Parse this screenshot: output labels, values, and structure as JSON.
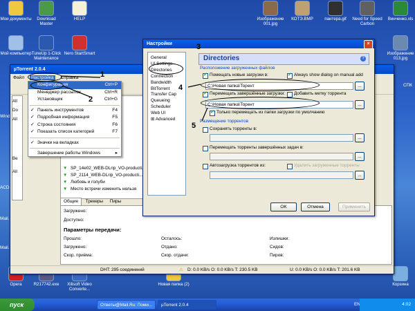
{
  "desktop_icons": [
    {
      "label": "Мои документы",
      "color": "#f0c840"
    },
    {
      "label": "Download Master",
      "color": "#4a9a4a"
    },
    {
      "label": "HELP",
      "color": "#f5f0d8"
    },
    {
      "label": "Изображение 001.jpg",
      "color": "#8a6a4a"
    },
    {
      "label": "КОТЭ.BMP",
      "color": "#c0a070"
    },
    {
      "label": "пантера.gif",
      "color": "#303030"
    },
    {
      "label": "Need for Speed Carbon",
      "color": "#606060"
    },
    {
      "label": "Винченко.xls",
      "color": "#2a8a3a"
    },
    {
      "label": "Мой компьютер",
      "color": "#a0c0e8"
    },
    {
      "label": "TuneUp 1-Click Maintenance",
      "color": "#2a5ab0"
    },
    {
      "label": "Nero StartSmart",
      "color": "#d03030"
    },
    {
      "label": "Изображение 013.jpg",
      "color": "#6a8ab0"
    },
    {
      "label": "Opera",
      "color": "#d02020"
    },
    {
      "label": "R217742.exe",
      "color": "#5a5a8a"
    },
    {
      "label": "Xilisoft Video Converte...",
      "color": "#3a6ac0"
    },
    {
      "label": "Новая папка (2)",
      "color": "#f0c840"
    },
    {
      "label": "Корзина",
      "color": "#7ab0e0"
    }
  ],
  "side_labels": [
    "Wind",
    "ACD",
    "Mail.",
    "Mail.",
    "СПК"
  ],
  "utorrent": {
    "title": "µTorrent 2.0.4",
    "menu": [
      "Файл",
      "Настройка",
      "Справка"
    ],
    "torrents": [
      "SP_14e02_WEB-DLrip_VO-producti...",
      "SP_2114_WEB-DLrip_VO-producti...",
      "Любовь и голуби",
      "Место встречи изменить нельзя"
    ],
    "list_snippet": "...DVDR...",
    "sidebar": [
      "All",
      "Do",
      "All",
      "Be",
      "All"
    ],
    "tabs": [
      "Общие",
      "Трекеры",
      "Пиры"
    ],
    "info_labels": [
      "Загружено:",
      "Доступно:"
    ],
    "params_title": "Параметры передачи:",
    "params": [
      [
        "Прошло:",
        "Осталось:",
        "Излишки:"
      ],
      [
        "Загружено:",
        "Отдано:",
        "Сидов:"
      ],
      [
        "Скор. приёма:",
        "Скор. отдачи:",
        "Пиров:"
      ]
    ],
    "status": {
      "dht": "DHT: 295 соединений",
      "down": "D: 0.0 KB/s O: 0.0 KB/s T: 230.5 KB",
      "up": "U: 0.0 KB/s O: 0.0 KB/s T: 201.6 KB"
    }
  },
  "dropdown": {
    "items": [
      {
        "label": "Конфигурация",
        "shortcut": "Ctrl+P",
        "check": false
      },
      {
        "label": "Менеджер рассылок",
        "shortcut": "Ctrl+R",
        "check": false
      },
      {
        "label": "Установщик",
        "shortcut": "Ctrl+G",
        "check": false
      },
      {
        "label": "Панель инструментов",
        "shortcut": "F4",
        "check": true
      },
      {
        "label": "Подробная информация",
        "shortcut": "F5",
        "check": true
      },
      {
        "label": "Строка состояния",
        "shortcut": "F6",
        "check": true
      },
      {
        "label": "Показать список категорий",
        "shortcut": "F7",
        "check": true
      },
      {
        "label": "Значки на вкладках",
        "shortcut": "",
        "check": true
      },
      {
        "label": "Завершение работы Windows",
        "shortcut": "▸",
        "check": false
      }
    ]
  },
  "settings": {
    "title": "Настройки",
    "tree": [
      "General",
      "UI Settings",
      "Directories",
      "Connection",
      "Bandwidth",
      "BitTorrent",
      "Transfer Cap",
      "Queueing",
      "Scheduler",
      "Web UI",
      "Advanced"
    ],
    "tree_advanced_expander": "⊞",
    "heading": "Directories",
    "help_glyph": "?",
    "section1": "Расположение загруженных файлов",
    "put_new": "Помещать новые загрузки в:",
    "always_show": "Always show dialog on manual add",
    "path1": "C:\\Новая папка\\Торент",
    "move_completed": "Перемещать завершённые загрузки:",
    "add_label": "Добавить метку торрента",
    "path2": "C:\\Новая папка\\Торент",
    "only_move": "Только перемещать из папки загрузки по умолчанию",
    "section2": "Размещение торрентов",
    "save_torrents": "Сохранять торренты в:",
    "move_finished": "Перемещать торренты завершённых задач в:",
    "autoload": "Автозагрузка торрентов из:",
    "delete_loaded": "Удалить загруженные торренты",
    "browse": "...",
    "ok": "OK",
    "cancel": "Отмена",
    "apply": "Применить"
  },
  "annotations": [
    "1",
    "2",
    "3",
    "4",
    "5"
  ],
  "taskbar": {
    "start": "пуск",
    "items": [
      "Ответы@Mail.Ru: Поми...",
      "µTorrent 2.0.4"
    ],
    "lang": "EN",
    "time": "4:02"
  }
}
